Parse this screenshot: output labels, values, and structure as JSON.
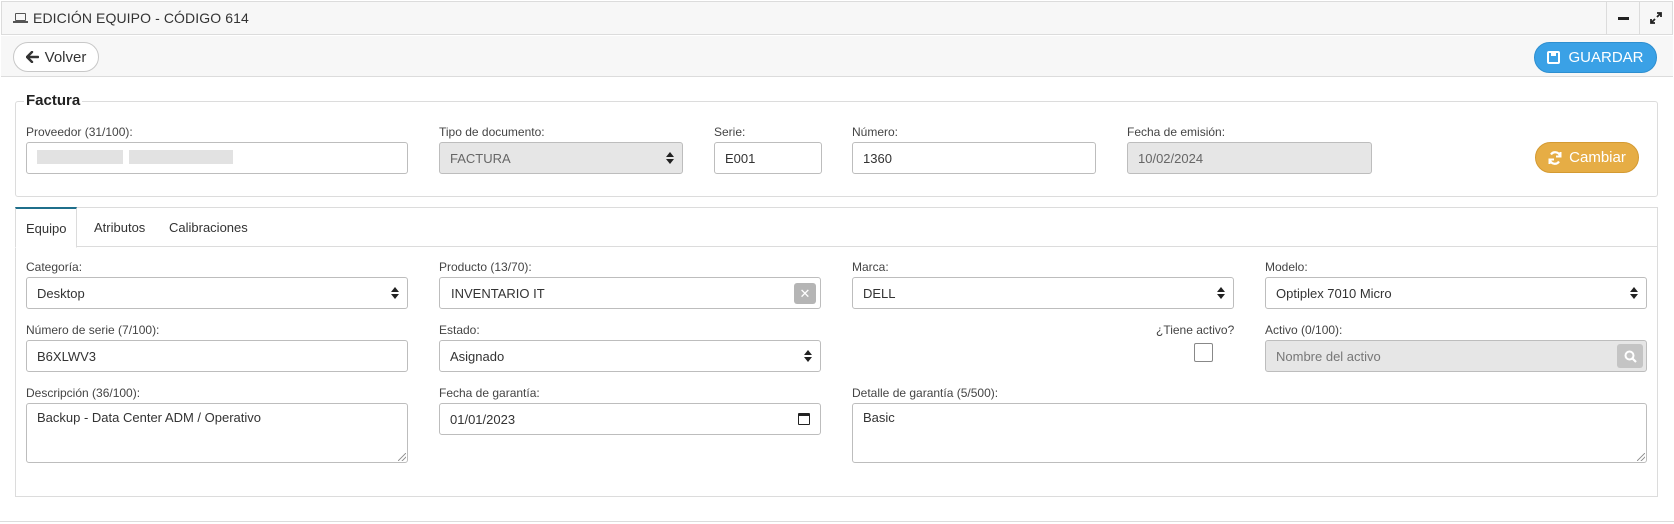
{
  "window": {
    "title": "EDICIÓN EQUIPO - CÓDIGO 614",
    "title_icon": "laptop-icon",
    "minimize_icon": "minimize-icon",
    "expand_icon": "expand-icon"
  },
  "toolbar": {
    "back_label": "Volver",
    "back_icon": "arrow-left-icon",
    "save_label": "GUARDAR",
    "save_icon": "floppy-disk-icon"
  },
  "factura": {
    "legend": "Factura",
    "proveedor": {
      "label": "Proveedor (31/100):",
      "value": ""
    },
    "tipo_documento": {
      "label": "Tipo de documento:",
      "value": "FACTURA"
    },
    "serie": {
      "label": "Serie:",
      "value": "E001"
    },
    "numero": {
      "label": "Número:",
      "value": "1360"
    },
    "fecha_emision": {
      "label": "Fecha de emisión:",
      "value": "10/02/2024"
    },
    "cambiar_label": "Cambiar",
    "cambiar_icon": "refresh-icon"
  },
  "tabs": [
    {
      "label": "Equipo",
      "active": true
    },
    {
      "label": "Atributos",
      "active": false
    },
    {
      "label": "Calibraciones",
      "active": false
    }
  ],
  "equipo": {
    "categoria": {
      "label": "Categoría:",
      "value": "Desktop"
    },
    "producto": {
      "label": "Producto (13/70):",
      "value": "INVENTARIO IT",
      "clear_icon": "clear-icon"
    },
    "marca": {
      "label": "Marca:",
      "value": "DELL"
    },
    "modelo": {
      "label": "Modelo:",
      "value": "Optiplex 7010 Micro"
    },
    "numero_serie": {
      "label": "Número de serie (7/100):",
      "value": "B6XLWV3"
    },
    "estado": {
      "label": "Estado:",
      "value": "Asignado"
    },
    "tiene_activo": {
      "label": "¿Tiene activo?",
      "checked": false
    },
    "activo": {
      "label": "Activo (0/100):",
      "placeholder": "Nombre del activo",
      "search_icon": "search-icon"
    },
    "descripcion": {
      "label": "Descripción (36/100):",
      "value": "Backup - Data Center ADM / Operativo"
    },
    "fecha_garantia": {
      "label": "Fecha de garantía:",
      "value": "01/01/2023",
      "calendar_icon": "calendar-icon"
    },
    "detalle_garantia": {
      "label": "Detalle de garantía (5/500):",
      "value": "Basic"
    }
  },
  "colors": {
    "save_button": "#3aa1e6",
    "change_button": "#e6ad45",
    "active_tab_border": "#1f6f8b",
    "disabled_field": "#e6e6e6"
  }
}
